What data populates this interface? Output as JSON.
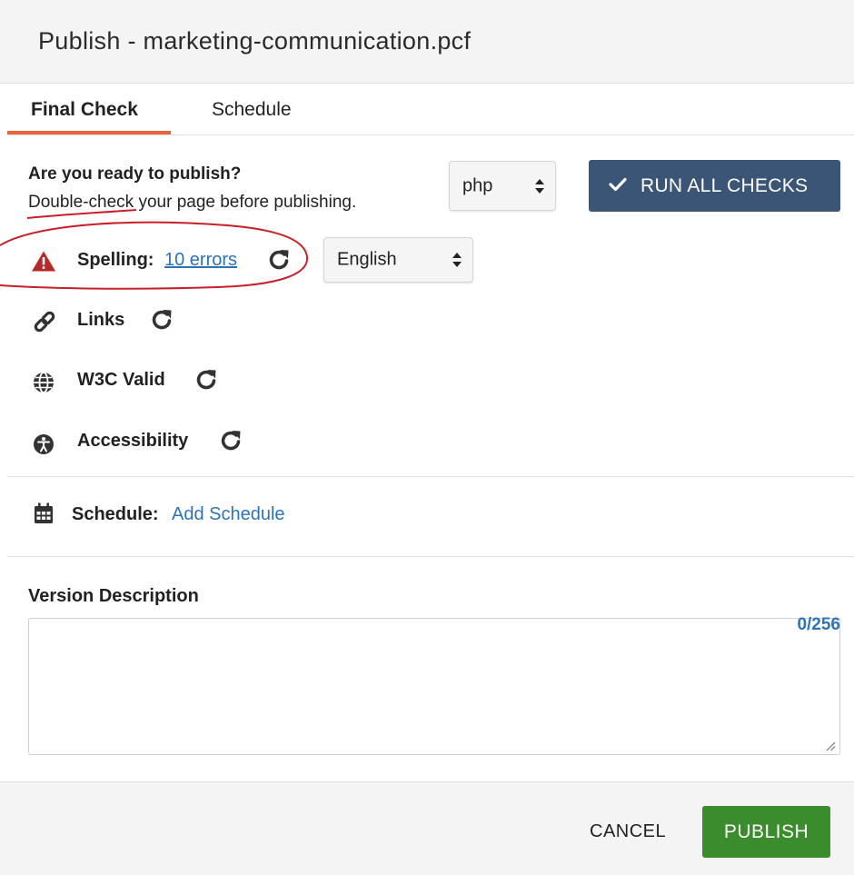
{
  "dialog": {
    "title": "Publish - marketing-communication.pcf"
  },
  "tabs": [
    {
      "label": "Final Check",
      "active": true
    },
    {
      "label": "Schedule",
      "active": false
    }
  ],
  "intro": {
    "question": "Are you ready to publish?",
    "subtitle": "Double-check your page before publishing."
  },
  "extension_select": {
    "value": "php"
  },
  "run_all_button": {
    "label": "RUN ALL CHECKS",
    "icon": "check-icon"
  },
  "checks": {
    "spelling": {
      "label": "Spelling:",
      "link": "10 errors",
      "icon": "warning-triangle-icon",
      "language": "English"
    },
    "links": {
      "label": "Links",
      "icon": "link-icon"
    },
    "w3c": {
      "label": "W3C Valid",
      "icon": "globe-icon"
    },
    "accessibility": {
      "label": "Accessibility",
      "icon": "accessibility-icon"
    }
  },
  "schedule": {
    "label": "Schedule:",
    "link": "Add Schedule",
    "icon": "calendar-icon"
  },
  "version": {
    "label": "Version Description",
    "value": "",
    "counter": "0/256"
  },
  "footer": {
    "cancel_label": "CANCEL",
    "publish_label": "PUBLISH"
  },
  "colors": {
    "accent_tab": "#e8643a",
    "run_button": "#3b5577",
    "publish_button": "#3b8c2c",
    "link": "#2f73b7",
    "warning": "#b22a2a",
    "annotation": "#c8202a"
  }
}
